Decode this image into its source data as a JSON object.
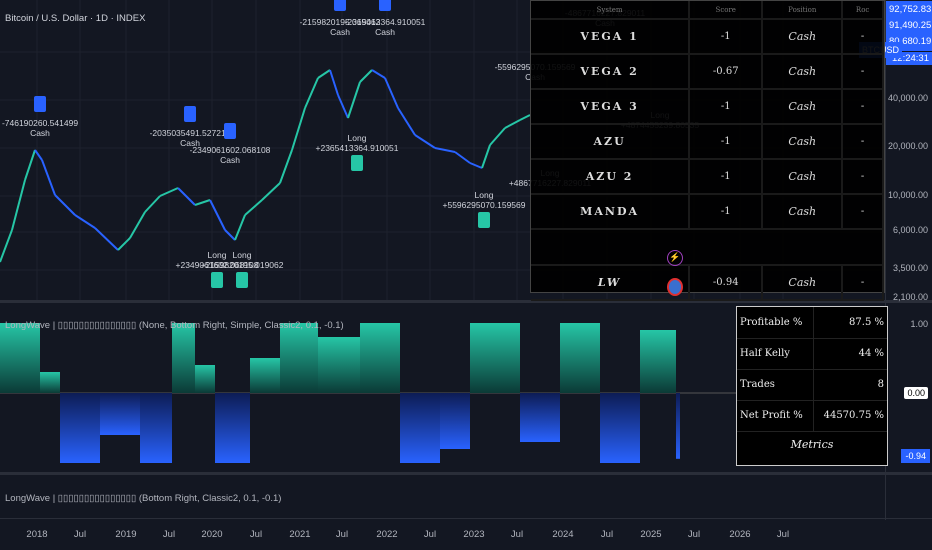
{
  "header": {
    "symbol_title": "Bitcoin / U.S. Dollar · 1D · INDEX"
  },
  "price_axis": {
    "labels": [
      "40,000.00",
      "20,000.00",
      "10,000.00",
      "6,000.00",
      "3,500.00",
      "2,100.00"
    ],
    "tags": {
      "high": "92,752.83",
      "prev": "91,490.25",
      "symbol": "BTCUSD",
      "last": "80,680.19",
      "countdown": "12:24:31"
    }
  },
  "indicator1": {
    "title": "LongWave | ▯▯▯▯▯▯▯▯▯▯▯▯▯▯▯ (None, Bottom Right, Simple, Classic2, 0.1, -0.1)",
    "axis": {
      "top": "1.00",
      "mid": "0.00",
      "current": "-0.94"
    }
  },
  "indicator2": {
    "title": "LongWave | ▯▯▯▯▯▯▯▯▯▯▯▯▯▯▯ (Bottom Right, Classic2, 0.1, -0.1)"
  },
  "system_table": {
    "headers": [
      "System",
      "Score",
      "Position",
      "Roc"
    ],
    "rows": [
      {
        "system": "VEGA 1",
        "score": "-1",
        "position": "Cash",
        "roc": "-"
      },
      {
        "system": "VEGA 2",
        "score": "-0.67",
        "position": "Cash",
        "roc": "-"
      },
      {
        "system": "VEGA 3",
        "score": "-1",
        "position": "Cash",
        "roc": "-"
      },
      {
        "system": "AZU",
        "score": "-1",
        "position": "Cash",
        "roc": "-"
      },
      {
        "system": "AZU 2",
        "score": "-1",
        "position": "Cash",
        "roc": "-"
      },
      {
        "system": "MANDA",
        "score": "-1",
        "position": "Cash",
        "roc": "-"
      }
    ],
    "total": {
      "system": "LW",
      "score": "-0.94",
      "position": "Cash",
      "roc": "-"
    }
  },
  "metrics": {
    "rows": [
      {
        "label": "Profitable %",
        "value": "87.5 %"
      },
      {
        "label": "Half Kelly",
        "value": "44 %"
      },
      {
        "label": "Trades",
        "value": "8"
      },
      {
        "label": "Net Profit %",
        "value": "44570.75 %"
      }
    ],
    "footer": "Metrics"
  },
  "annotations": [
    {
      "text": "-746190260.541499",
      "sub": "Cash"
    },
    {
      "text": "-2035035491.527216",
      "sub": "Cash"
    },
    {
      "text": "-2349061602.068108",
      "sub": "Cash"
    },
    {
      "text": "-2159820195.019062",
      "sub": "Cash"
    },
    {
      "text": "-2365413364.910051",
      "sub": "Cash"
    },
    {
      "text": "-5596295070.159569",
      "sub": "Cash"
    },
    {
      "text": "-4867716227.829011",
      "sub": "Cash"
    },
    {
      "text": "Long",
      "sub": "+2349061602.068108"
    },
    {
      "text": "Long",
      "sub": "+2159820195.019062"
    },
    {
      "text": "Long",
      "sub": "+2365413364.910051"
    },
    {
      "text": "Long",
      "sub": "+5596295070.159569"
    },
    {
      "text": "Long",
      "sub": "+4867716227.829011"
    },
    {
      "text": "Long",
      "sub": "+4874455239.80535"
    }
  ],
  "time_axis": [
    "2018",
    "Jul",
    "2019",
    "Jul",
    "2020",
    "Jul",
    "2021",
    "Jul",
    "2022",
    "Jul",
    "2023",
    "Jul",
    "2024",
    "Jul",
    "2025",
    "Jul",
    "2026",
    "Jul"
  ],
  "colors": {
    "bull": "#26c6a6",
    "bear": "#2962ff",
    "signal": "#c21ad6"
  }
}
